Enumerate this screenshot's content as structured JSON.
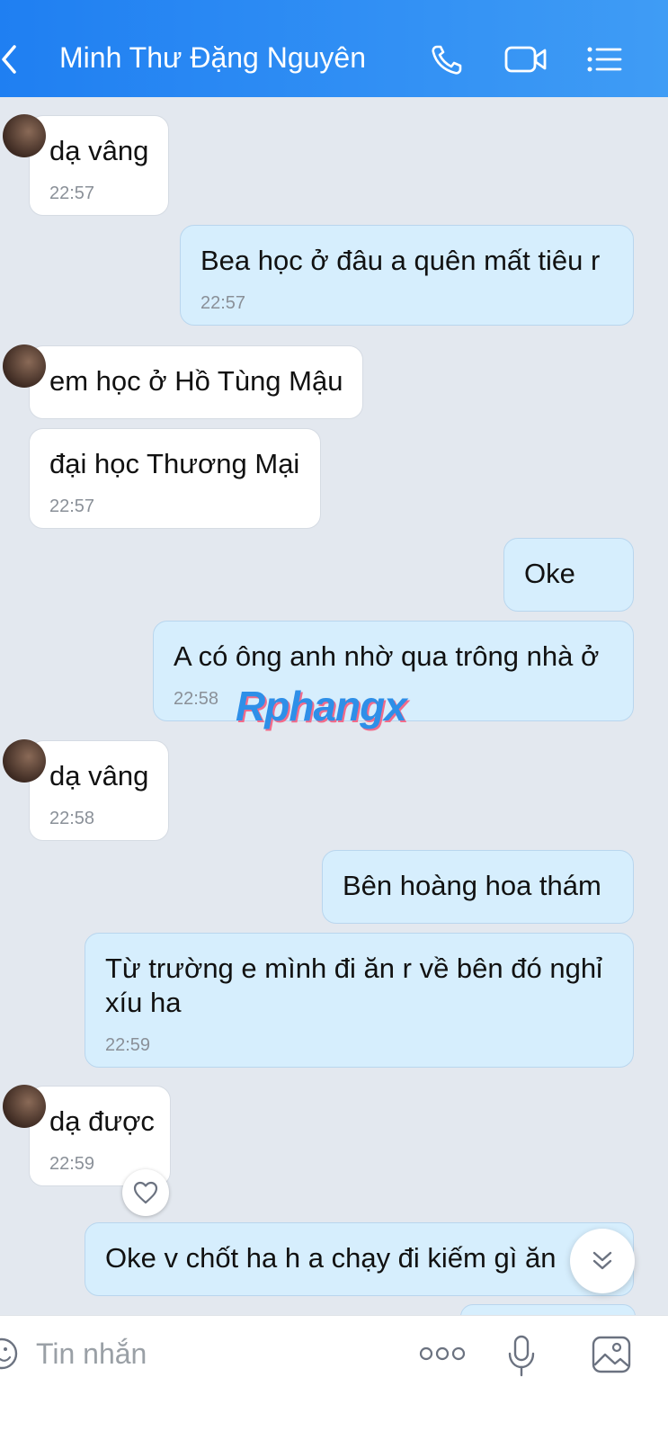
{
  "header": {
    "contact_name": "Minh Thư Đặng Nguyên",
    "icons": [
      "back-chevron-icon",
      "phone-icon",
      "video-call-icon",
      "menu-list-icon"
    ]
  },
  "messages": [
    {
      "side": "in",
      "text": "dạ vâng",
      "time": "22:57"
    },
    {
      "side": "out",
      "text": "Bea học ở đâu a quên mất tiêu r",
      "time": "22:57"
    },
    {
      "side": "in",
      "text": "em học ở Hồ Tùng Mậu",
      "time": ""
    },
    {
      "side": "in",
      "text": "đại học Thương Mại",
      "time": "22:57"
    },
    {
      "side": "out",
      "text": "Oke",
      "time": ""
    },
    {
      "side": "out",
      "text": "A có ông anh nhờ qua trông nhà ở",
      "time": "22:58"
    },
    {
      "side": "in",
      "text": "dạ vâng",
      "time": "22:58"
    },
    {
      "side": "out",
      "text": "Bên hoàng hoa thám",
      "time": ""
    },
    {
      "side": "out",
      "text": "Từ trường e mình đi ăn r về bên đó nghỉ xíu ha",
      "time": "22:59"
    },
    {
      "side": "in",
      "text": "dạ được",
      "time": "22:59"
    },
    {
      "side": "out",
      "text": "Oke v chốt ha h a chạy đi kiếm gì ăn",
      "time": ""
    }
  ],
  "watermark": "Rphangx",
  "composer": {
    "placeholder": "Tin nhắn",
    "icons": [
      "sticker-icon",
      "more-options-icon",
      "microphone-icon",
      "image-icon"
    ]
  },
  "colors": {
    "header_gradient_start": "#1f7ff2",
    "header_gradient_end": "#3f9cf5",
    "background": "#e3e8ef",
    "incoming_bubble": "#ffffff",
    "outgoing_bubble": "#d6eefd"
  }
}
